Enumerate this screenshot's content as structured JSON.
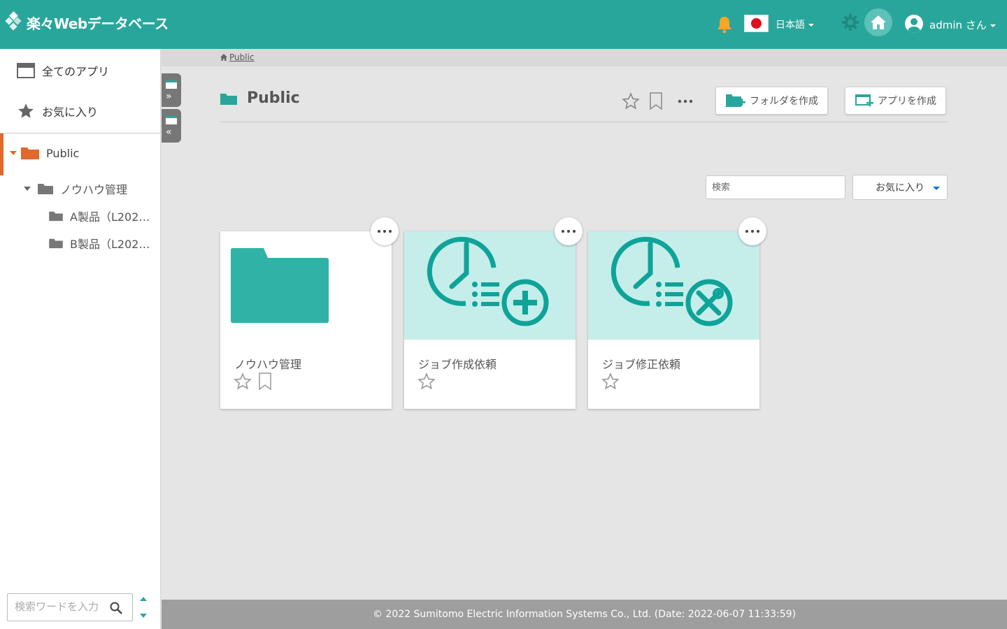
{
  "header": {
    "logo_text": "楽々Webデータベース",
    "language": "日本語",
    "user": "admin さん"
  },
  "sidebar": {
    "all_apps": "全てのアプリ",
    "favorites": "お気に入り",
    "tree": {
      "root": "Public",
      "child": "ノウハウ管理",
      "grandchildren": [
        "A製品（L202…",
        "B製品（L202…"
      ]
    },
    "search_placeholder": "検索ワードを入力"
  },
  "breadcrumb": {
    "item": "Public"
  },
  "main": {
    "title": "Public",
    "create_folder": "フォルダを作成",
    "create_app": "アプリを作成",
    "search_placeholder": "検索",
    "filter_value": "お気に入り"
  },
  "cards": [
    {
      "title": "ノウハウ管理",
      "type": "folder"
    },
    {
      "title": "ジョブ作成依頼",
      "type": "app-add"
    },
    {
      "title": "ジョブ修正依頼",
      "type": "app-fix"
    }
  ],
  "footer": {
    "text": "© 2022 Sumitomo Electric Information Systems Co., Ltd. (Date: 2022-06-07 11:33:59)"
  },
  "colors": {
    "brand": "#29a69b",
    "accent": "#e0692b",
    "thumb": "#c5eeea"
  }
}
